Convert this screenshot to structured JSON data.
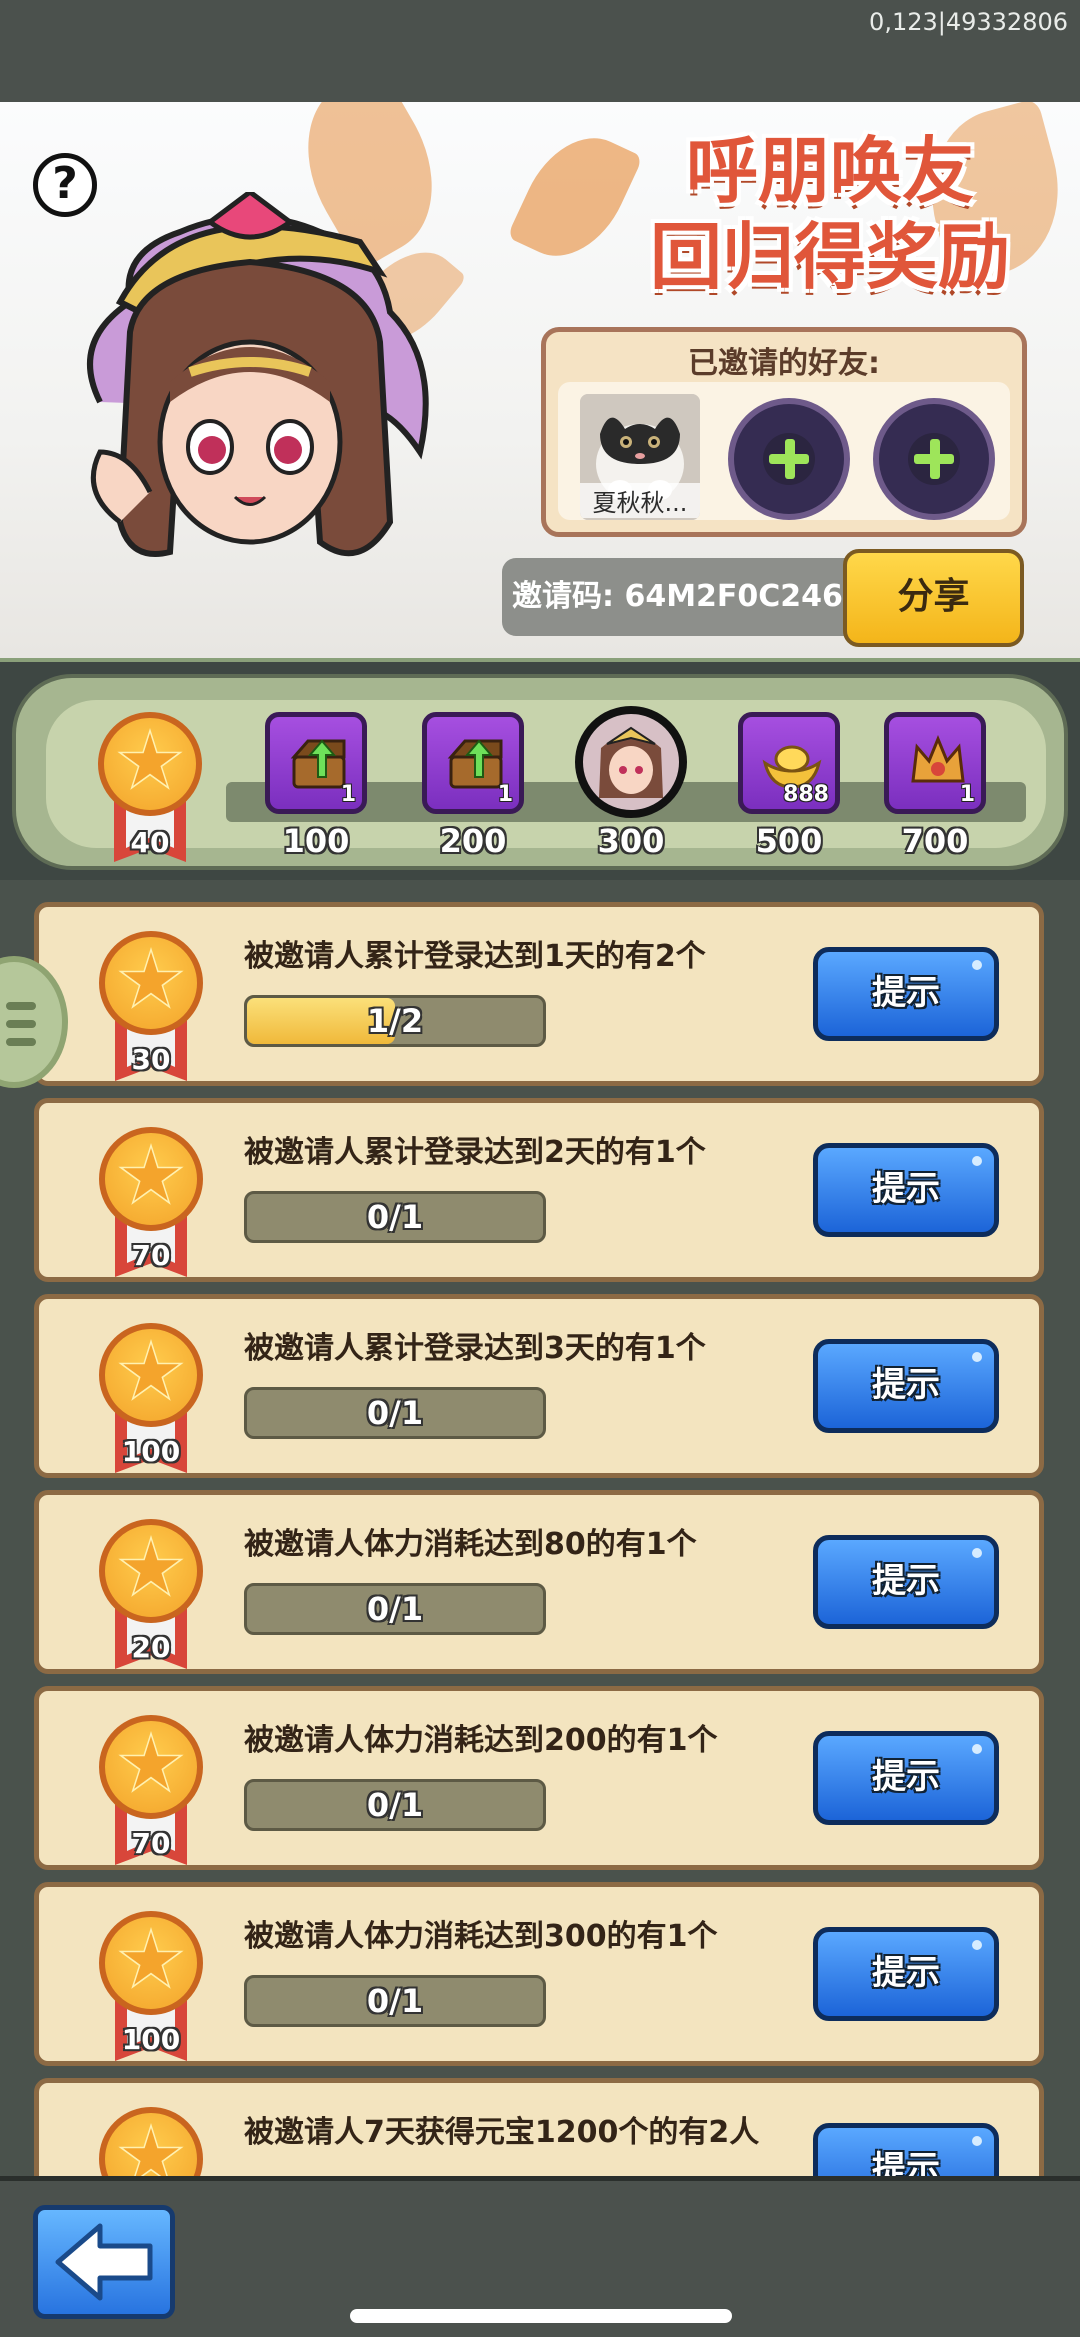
{
  "status_text": "0,123|49332806",
  "banner": {
    "title_line1": "呼朋唤友",
    "title_line2": "回归得奖励",
    "friends_title": "已邀请的好友:",
    "friend_name": "夏秋秋...",
    "invite_code": "邀请码: 64M2F0C246",
    "share_label": "分享"
  },
  "progress": {
    "current_points": "40",
    "fill_fraction": 0.0,
    "milestones": [
      {
        "label": "100",
        "count": "1",
        "icon": "chest-upgrade-icon"
      },
      {
        "label": "200",
        "count": "1",
        "icon": "chest-upgrade-icon"
      },
      {
        "label": "300",
        "count": "",
        "icon": "hero-avatar-icon"
      },
      {
        "label": "500",
        "count": "888",
        "icon": "gold-ingot-icon"
      },
      {
        "label": "700",
        "count": "1",
        "icon": "crown-icon"
      }
    ]
  },
  "tasks": [
    {
      "text": "被邀请人累计登录达到1天的有2个",
      "medal": "30",
      "progress": "1/2",
      "fraction": 0.5,
      "button": "提示"
    },
    {
      "text": "被邀请人累计登录达到2天的有1个",
      "medal": "70",
      "progress": "0/1",
      "fraction": 0,
      "button": "提示"
    },
    {
      "text": "被邀请人累计登录达到3天的有1个",
      "medal": "100",
      "progress": "0/1",
      "fraction": 0,
      "button": "提示"
    },
    {
      "text": "被邀请人体力消耗达到80的有1个",
      "medal": "20",
      "progress": "0/1",
      "fraction": 0,
      "button": "提示"
    },
    {
      "text": "被邀请人体力消耗达到200的有1个",
      "medal": "70",
      "progress": "0/1",
      "fraction": 0,
      "button": "提示"
    },
    {
      "text": "被邀请人体力消耗达到300的有1个",
      "medal": "100",
      "progress": "0/1",
      "fraction": 0,
      "button": "提示"
    },
    {
      "text": "被邀请人7天获得元宝1200个的有2人",
      "medal": "",
      "progress": "",
      "fraction": 0,
      "button": "提示"
    }
  ]
}
